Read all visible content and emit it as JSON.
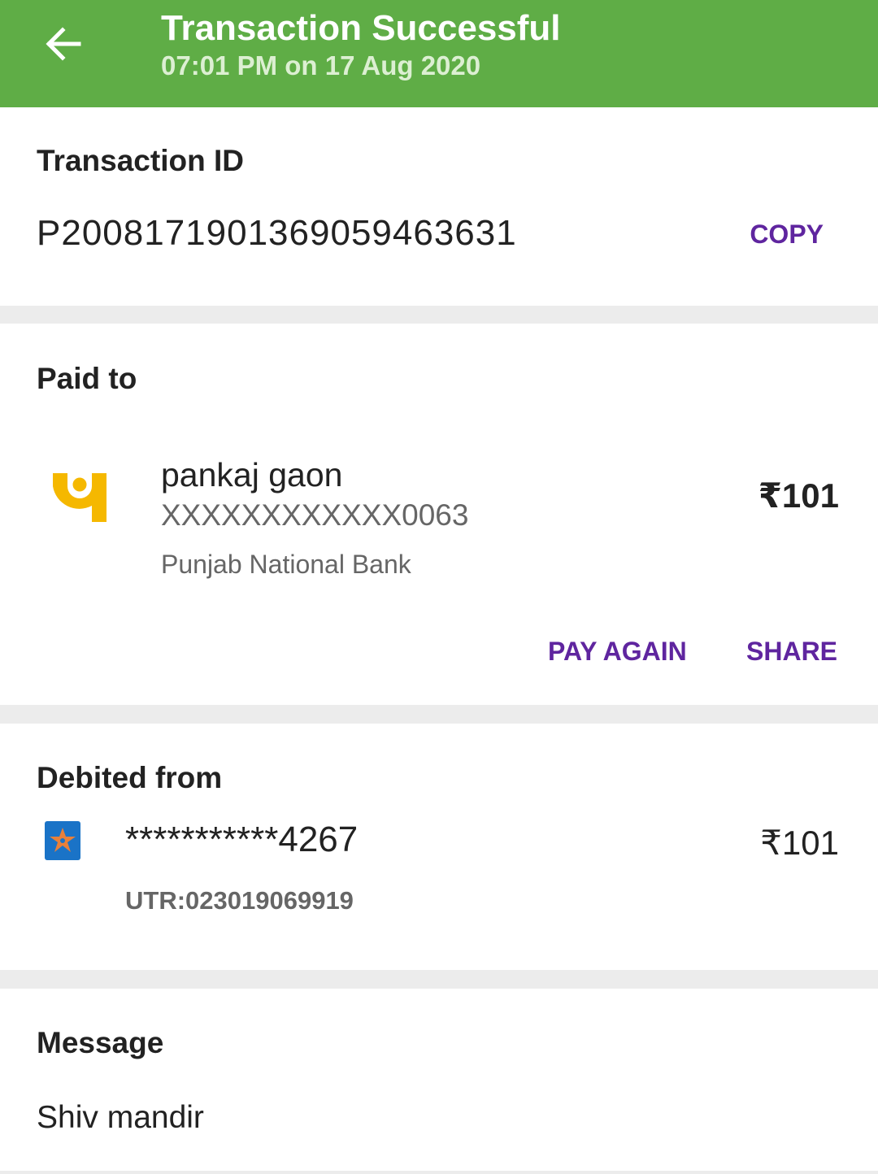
{
  "header": {
    "title": "Transaction Successful",
    "subtitle": "07:01 PM on 17 Aug 2020",
    "back_icon": "arrow-left-icon",
    "color": "#5fad46"
  },
  "transaction": {
    "label": "Transaction ID",
    "id": "P2008171901369059463631",
    "copy_label": "COPY"
  },
  "paid_to": {
    "label": "Paid to",
    "name": "pankaj gaon",
    "account": "XXXXXXXXXXXX0063",
    "bank": "Punjab National Bank",
    "amount": "₹101",
    "logo_icon": "pnb-logo-icon",
    "pay_again_label": "PAY AGAIN",
    "share_label": "SHARE"
  },
  "debited_from": {
    "label": "Debited from",
    "account": "***********4267",
    "amount": "₹101",
    "utr": "UTR:023019069919",
    "logo_icon": "bank-logo-icon"
  },
  "message": {
    "label": "Message",
    "text": "Shiv mandir"
  },
  "colors": {
    "accent": "#5f259f",
    "success": "#5fad46",
    "divider": "#ececec"
  }
}
